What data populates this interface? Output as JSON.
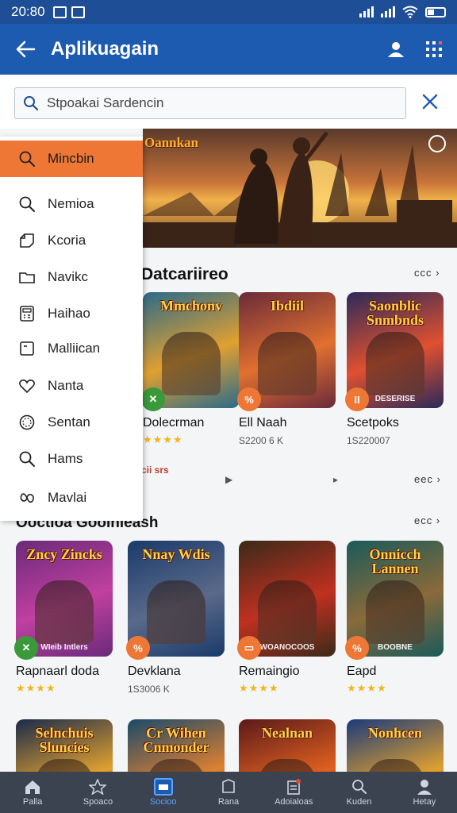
{
  "status_bar": {
    "time": "20:80"
  },
  "app_bar": {
    "title": "Aplikuagain"
  },
  "search": {
    "placeholder": "Stpoakai Sardencin"
  },
  "hero": {
    "brand": "Oannkan"
  },
  "menu": {
    "items": [
      {
        "label": "Mincbin",
        "icon": "search-icon",
        "active": true
      },
      {
        "label": "Nemioa",
        "icon": "search-icon"
      },
      {
        "label": "Kcoria",
        "icon": "puzzle-icon"
      },
      {
        "label": "Navikc",
        "icon": "folder-icon"
      },
      {
        "label": "Haihao",
        "icon": "calculator-icon"
      },
      {
        "label": "Malliican",
        "icon": "square-icon"
      },
      {
        "label": "Nanta",
        "icon": "heart-icon"
      },
      {
        "label": "Sentan",
        "icon": "compass-icon"
      },
      {
        "label": "Hams",
        "icon": "search-icon"
      },
      {
        "label": "Mavlai",
        "icon": "infinity-icon"
      }
    ]
  },
  "section1": {
    "title": "Datcariireo",
    "more": "ccc",
    "link": "cii srs",
    "more2": "eec",
    "games": [
      {
        "name": "Dolecrman",
        "art_title": "Mmchonv",
        "badge": "✕",
        "badge_color": "#3a9a3a",
        "meta": "",
        "stars": "★★★★",
        "art_bg": "#2a6a8a",
        "art_mid": "#e0a030"
      },
      {
        "name": "Ell Naah",
        "art_title": "Ibdiil",
        "badge": "%",
        "badge_color": "#ee7736",
        "meta": "S2200 6 K",
        "stars": "",
        "art_bg": "#6a2a3a",
        "art_mid": "#e07030"
      },
      {
        "name": "Scetpoks",
        "art_title": "Saonblic Snmbnds",
        "badge": "II",
        "badge_color": "#ee7736",
        "meta": "1S220007",
        "stars": "",
        "art_bg": "#2a2a5a",
        "art_mid": "#e05030",
        "sub": "DESERISE"
      }
    ]
  },
  "section2": {
    "title": "Ooctioa Gooinleash",
    "more": "ecc",
    "games": [
      {
        "name": "Rapnaarl doda",
        "art_title": "Zncy Zincks",
        "badge": "✕",
        "badge_color": "#3a9a3a",
        "meta": "",
        "stars": "★★★★",
        "art_bg": "#6a2a7a",
        "art_mid": "#c040a0",
        "sub": "WIeib Intlers"
      },
      {
        "name": "Devklana",
        "art_title": "Nnay Wdis",
        "badge": "%",
        "badge_color": "#ee7736",
        "meta": "1S3006 K",
        "stars": "",
        "art_bg": "#1a3a6a",
        "art_mid": "#5a6a8a"
      },
      {
        "name": "Remaingio",
        "art_title": "",
        "badge": "▭",
        "badge_color": "#ee7736",
        "meta": "",
        "stars": "★★★★",
        "art_bg": "#3a2a1a",
        "art_mid": "#c03020",
        "sub": "WOANOCOOS"
      },
      {
        "name": "Eapd",
        "art_title": "Onnicch Lannen",
        "badge": "%",
        "badge_color": "#ee7736",
        "meta": "",
        "stars": "★★★★",
        "art_bg": "#1a5a5a",
        "art_mid": "#8a6a3a",
        "sub": "BOOBNE"
      }
    ],
    "row2": [
      {
        "art_title": "Selnchuis Sluncies",
        "art_bg": "#1a2a4a",
        "art_mid": "#e0a030"
      },
      {
        "art_title": "Cr Wihen Cnmonder",
        "art_bg": "#1a4a6a",
        "art_mid": "#e08030"
      },
      {
        "art_title": "Nealnan",
        "art_bg": "#5a1a1a",
        "art_mid": "#e06020"
      },
      {
        "art_title": "Nonhcen",
        "art_bg": "#1a3a7a",
        "art_mid": "#e0a030"
      }
    ]
  },
  "bottom_nav": [
    {
      "label": "Palla",
      "icon": "home-icon"
    },
    {
      "label": "Spoaco",
      "icon": "star-icon"
    },
    {
      "label": "Socioo",
      "icon": "store-icon",
      "active": true
    },
    {
      "label": "Rana",
      "icon": "shield-icon"
    },
    {
      "label": "Adoialoas",
      "icon": "clipboard-icon"
    },
    {
      "label": "Kuden",
      "icon": "search-icon"
    },
    {
      "label": "Hetay",
      "icon": "person-icon"
    }
  ]
}
